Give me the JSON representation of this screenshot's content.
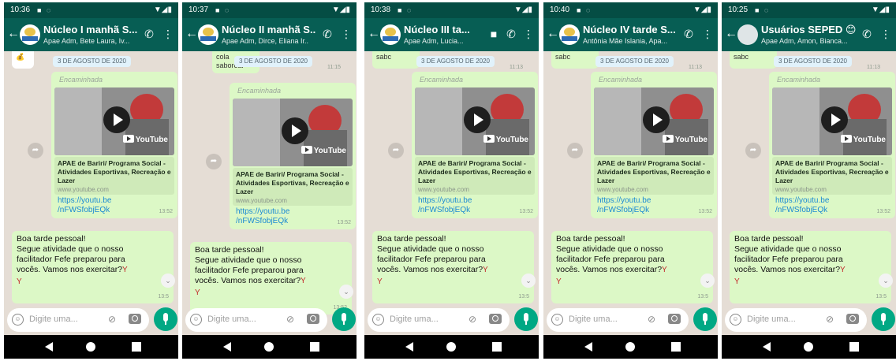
{
  "shared": {
    "date_chip": "3 DE AGOSTO DE 2020",
    "forwarded_label": "Encaminhada",
    "youtube_wordmark": "YouTube",
    "link_title": "APAE de Bariri/ Programa Social - Atividades Esportivas, Recreação e Lazer",
    "link_domain": "www.youtube.com",
    "link_url_line1": "https://youtu.be",
    "link_url_line2": "/nFWSfobjEQk",
    "message_lines": [
      "Boa tarde pessoal!",
      "Segue atividade que o nosso",
      "facilitador Fefe preparou para",
      "vocês. Vamos nos exercitar?"
    ],
    "input_placeholder": "Digite uma...",
    "colors": {
      "header": "#075e54",
      "statusbar": "#054d44",
      "bubble": "#dcf8c6",
      "accent": "#00a884",
      "link": "#1b8ad3",
      "chat_bg": "#e5ddd5"
    }
  },
  "phones": [
    {
      "time": "10:36",
      "title": "Núcleo I manhã S...",
      "subtitle": "Apae Adm, Bete Laura, Iv...",
      "card_time": "13:52",
      "text_time": "13:5",
      "peek_text": "",
      "peek_time": ""
    },
    {
      "time": "10:37",
      "title": "Núcleo II manhã S...",
      "subtitle": "Apae Adm, Dirce, Eliana Ir...",
      "card_time": "13:52",
      "text_time": "13:52",
      "peek_text": "cola saborear",
      "peek_time": "11:15"
    },
    {
      "time": "10:38",
      "title": "Núcleo III ta...",
      "subtitle": "Apae Adm, Lucia...",
      "card_time": "13:52",
      "text_time": "13:5",
      "peek_text": "sabc",
      "peek_time": "11:13"
    },
    {
      "time": "10:40",
      "title": "Núcleo IV tarde S...",
      "subtitle": "Antônia Mãe Islania, Apa...",
      "card_time": "13:52",
      "text_time": "13:5",
      "peek_text": "sabc",
      "peek_time": "11:13"
    },
    {
      "time": "10:25",
      "title": "Usuários SEPED 😊",
      "subtitle": "Apae Adm, Amon, Bianca...",
      "card_time": "13:52",
      "text_time": "13:5",
      "peek_text": "sabc",
      "peek_time": "11:13"
    }
  ]
}
